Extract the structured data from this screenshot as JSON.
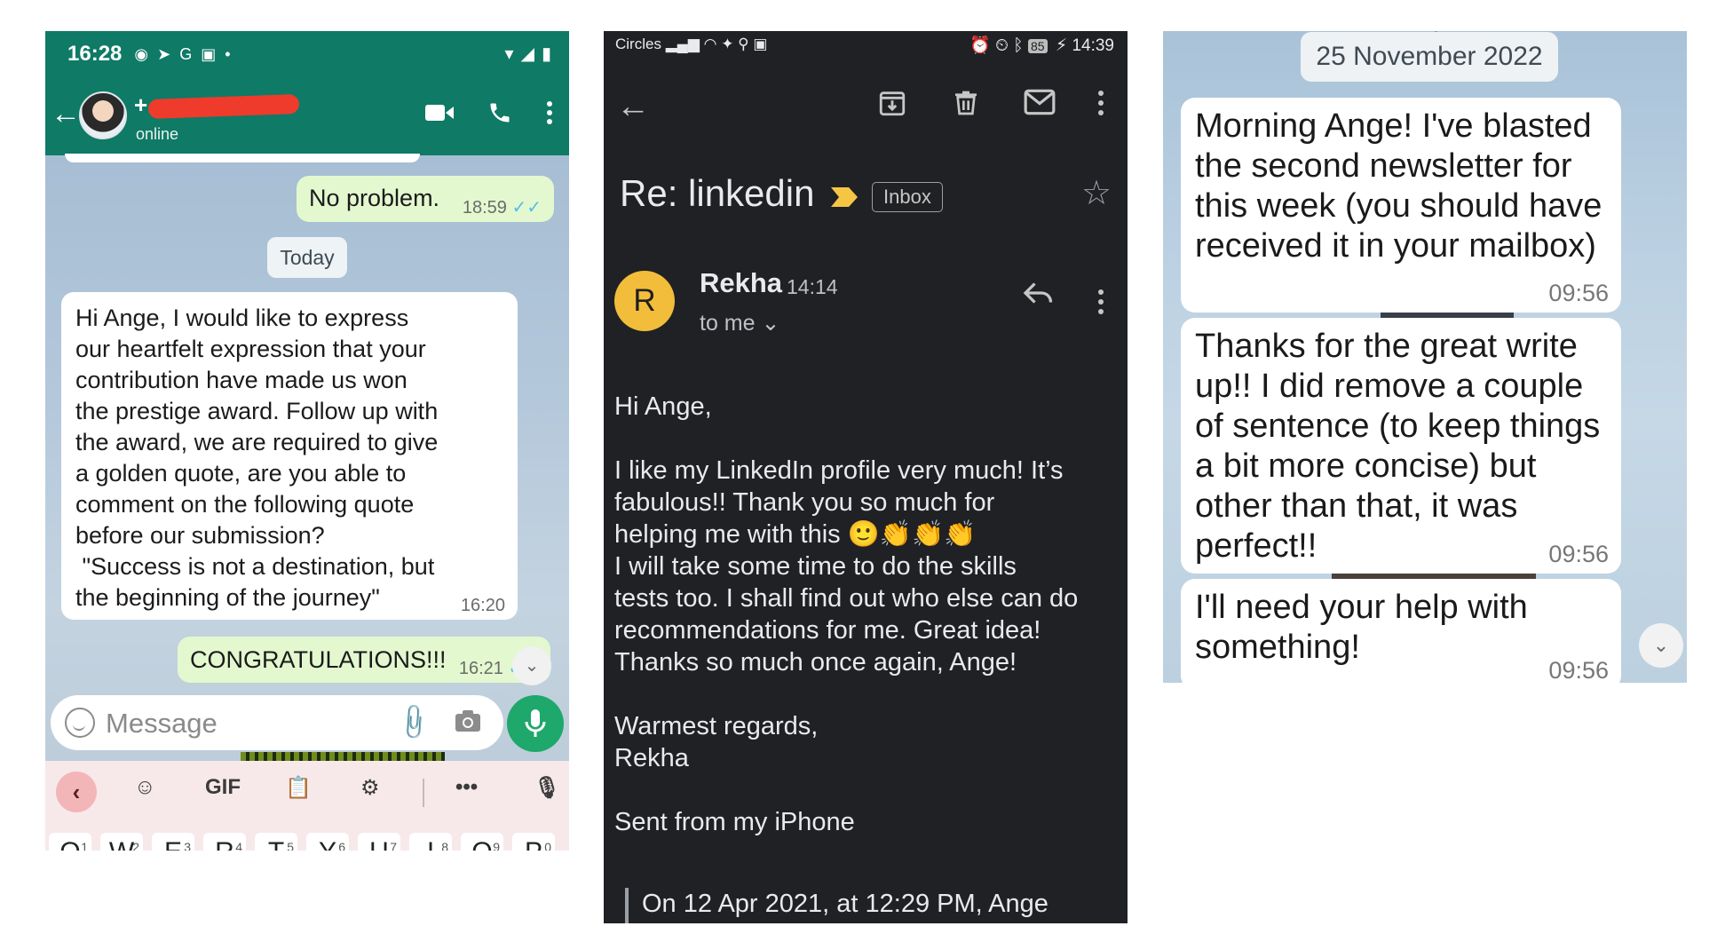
{
  "whatsapp": {
    "status_time": "16:28",
    "contact_prefix": "+",
    "contact_status": "online",
    "messages": [
      {
        "text": "No problem.",
        "time": "18:59"
      },
      {
        "text": "Hi Ange, I would like to express\nour heartfelt expression that your\ncontribution have made us won\nthe prestige award. Follow up with\nthe award, we are required to give\na golden quote, are you able to\ncomment on the following quote\nbefore our submission?\n \"Success is not a destination, but\nthe beginning of the journey\"",
        "time": "16:20"
      },
      {
        "text": "CONGRATULATIONS!!!",
        "time": "16:21"
      }
    ],
    "date_divider": "Today",
    "input_placeholder": "Message",
    "keyboard": {
      "gif_label": "GIF",
      "more_label": "•••",
      "keys": [
        "Q",
        "W",
        "E",
        "R",
        "T",
        "Y",
        "U",
        "I",
        "O",
        "P"
      ],
      "key_hints": [
        "1",
        "2",
        "3",
        "4",
        "5",
        "6",
        "7",
        "8",
        "9",
        "0"
      ]
    },
    "colors": {
      "header": "#0f7a66",
      "outgoing": "#e3f8cf",
      "mic": "#1ea86b"
    }
  },
  "gmail": {
    "status_carrier": "Circles",
    "status_battery": "85",
    "status_time": "14:39",
    "subject": "Re: linkedin",
    "label": "Inbox",
    "sender_initial": "R",
    "sender_name": "Rekha",
    "sent_time": "14:14",
    "recipient": "to me",
    "body": "Hi Ange,\n\nI like my LinkedIn profile very much! It’s\nfabulous!! Thank you so much for\nhelping me with this 🙂👏👏👏\nI will take some time to do the skills\ntests too. I shall find out who else can do\nrecommendations for me. Great idea!\nThanks so much once again, Ange!\n\nWarmest regards,\nRekha\n\nSent from my iPhone",
    "quoted_header": "On 12 Apr 2021, at 12:29 PM, Ange",
    "colors": {
      "background": "#202124",
      "avatar": "#f2bd3a",
      "important": "#f6c544"
    }
  },
  "chat": {
    "date_header": "25 November 2022",
    "messages": [
      {
        "text": "Morning Ange! I've blasted the second newsletter for this week (you should have received it in your mailbox)",
        "time": "09:56"
      },
      {
        "text": "Thanks for the great write up!! I did remove a couple of sentence (to keep things a bit more concise) but other than that, it was perfect!!",
        "time": "09:56"
      },
      {
        "text": "I'll need your help with something!",
        "time": "09:56"
      }
    ]
  }
}
